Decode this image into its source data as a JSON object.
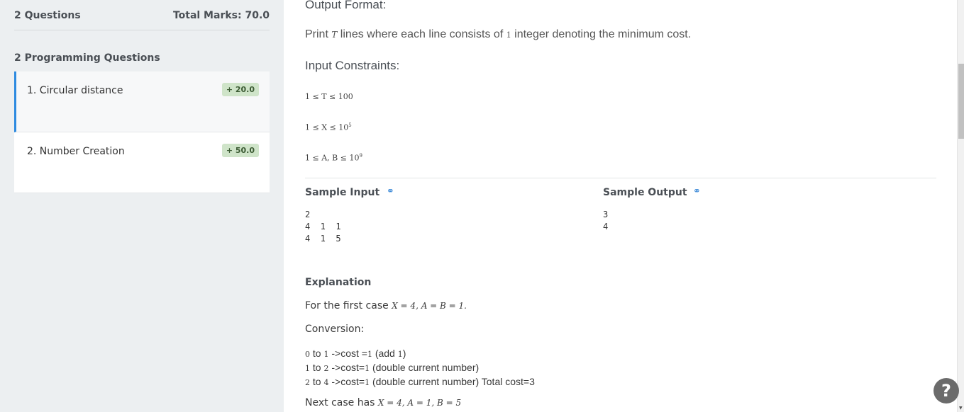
{
  "sidebar": {
    "questions_count": "2 Questions",
    "total_marks": "Total Marks: 70.0",
    "section_title": "2 Programming Questions",
    "items": [
      {
        "label": "1. Circular distance",
        "marks": "+ 20.0"
      },
      {
        "label": "2. Number Creation",
        "marks": "+ 50.0"
      }
    ]
  },
  "problem": {
    "output_format_heading": "Output Format:",
    "output_text_pre": "Print ",
    "output_var": "T",
    "output_text_mid": " lines where each line consists of ",
    "output_num": "1",
    "output_text_post": " integer denoting the minimum cost.",
    "constraints_heading": "Input Constraints:",
    "constraints": [
      "1 ≤ T ≤ 100",
      "1 ≤ X ≤ 10",
      "1 ≤ A, B ≤ 10"
    ],
    "constraint_exponents": [
      "",
      "5",
      "9"
    ],
    "sample_input_label": "Sample Input",
    "sample_output_label": "Sample Output",
    "sample_input": "2\n4  1  1\n4  1  5",
    "sample_output": "3\n4",
    "explanation_heading": "Explanation",
    "explanation_first_pre": "For the first case ",
    "explanation_first_math": "X = 4, A = B = 1.",
    "conversion_label": "Conversion:",
    "conversion_lines": [
      {
        "a": "0",
        "b": "1",
        "text1": " ->cost =",
        "c": "1",
        "text2": " (add ",
        "d": "1",
        "text3": ")"
      },
      {
        "a": "1",
        "b": "2",
        "text1": " ->cost=",
        "c": "1",
        "text2": " (double current number)",
        "d": "",
        "text3": ""
      },
      {
        "a": "2",
        "b": "4",
        "text1": " ->cost=",
        "c": "1",
        "text2": " (double current number) Total cost=",
        "d": "3",
        "text3": ""
      }
    ],
    "next_case_pre": "Next case has ",
    "next_case_math": "X = 4, A = 1, B = 5"
  },
  "help_label": "?"
}
